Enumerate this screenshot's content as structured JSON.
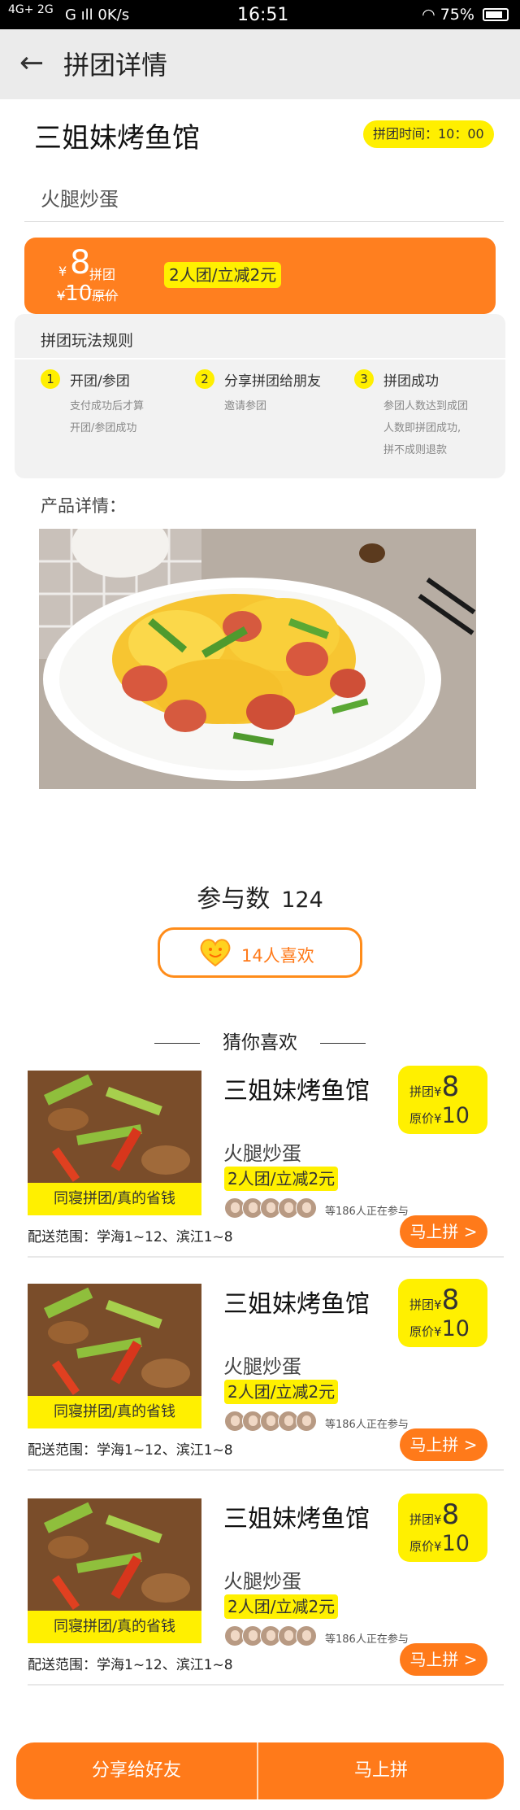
{
  "status_bar": {
    "network_left": "4G+ 2G",
    "network": "G ıll 0K/s",
    "time": "16:51",
    "battery": "75%"
  },
  "header": {
    "title": "拼团详情"
  },
  "shop": {
    "name": "三姐妹烤鱼馆",
    "time_badge": "拼团时间：10：00",
    "dish": "火腿炒蛋"
  },
  "price_banner": {
    "currency": "¥",
    "group_price": "8",
    "group_label": "拼团",
    "original_price": "10",
    "original_label": "原价",
    "promo": "2人团/立减2元"
  },
  "rules": {
    "title": "拼团玩法规则",
    "steps": [
      {
        "num": "1",
        "label": "开团/参团",
        "desc_line1": "支付成功后才算",
        "desc_line2": "开团/参团成功",
        "desc_line3": ""
      },
      {
        "num": "2",
        "label": "分享拼团给朋友",
        "desc_line1": "邀请参团",
        "desc_line2": "",
        "desc_line3": ""
      },
      {
        "num": "3",
        "label": "拼团成功",
        "desc_line1": "参团人数达到成团",
        "desc_line2": "人数即拼团成功,",
        "desc_line3": "拼不成则退款"
      }
    ]
  },
  "detail_label": "产品详情：",
  "participants": {
    "label": "参与数",
    "count": "124"
  },
  "likes": {
    "label": "14人喜欢"
  },
  "guess_title": "猜你喜欢",
  "recommendations": [
    {
      "shop": "三姐妹烤鱼馆",
      "group_label": "拼团",
      "group_price": "8",
      "orig_label": "原价",
      "orig_price": "10",
      "currency": "¥",
      "dish": "火腿炒蛋",
      "promo": "2人团/立减2元",
      "thumb_tag": "同寝拼团/真的省钱",
      "joining": "等186人正在参与",
      "delivery": "配送范围：学海1~12、滨江1~8",
      "join_button": "马上拼 >"
    },
    {
      "shop": "三姐妹烤鱼馆",
      "group_label": "拼团",
      "group_price": "8",
      "orig_label": "原价",
      "orig_price": "10",
      "currency": "¥",
      "dish": "火腿炒蛋",
      "promo": "2人团/立减2元",
      "thumb_tag": "同寝拼团/真的省钱",
      "joining": "等186人正在参与",
      "delivery": "配送范围：学海1~12、滨江1~8",
      "join_button": "马上拼 >"
    },
    {
      "shop": "三姐妹烤鱼馆",
      "group_label": "拼团",
      "group_price": "8",
      "orig_label": "原价",
      "orig_price": "10",
      "currency": "¥",
      "dish": "火腿炒蛋",
      "promo": "2人团/立减2元",
      "thumb_tag": "同寝拼团/真的省钱",
      "joining": "等186人正在参与",
      "delivery": "配送范围：学海1~12、滨江1~8",
      "join_button": "马上拼 >"
    }
  ],
  "action_bar": {
    "share": "分享给好友",
    "join": "马上拼"
  },
  "colors": {
    "accent_orange": "#ff7a1a",
    "highlight_yellow": "#fff000",
    "header_bg": "#ebebeb"
  }
}
